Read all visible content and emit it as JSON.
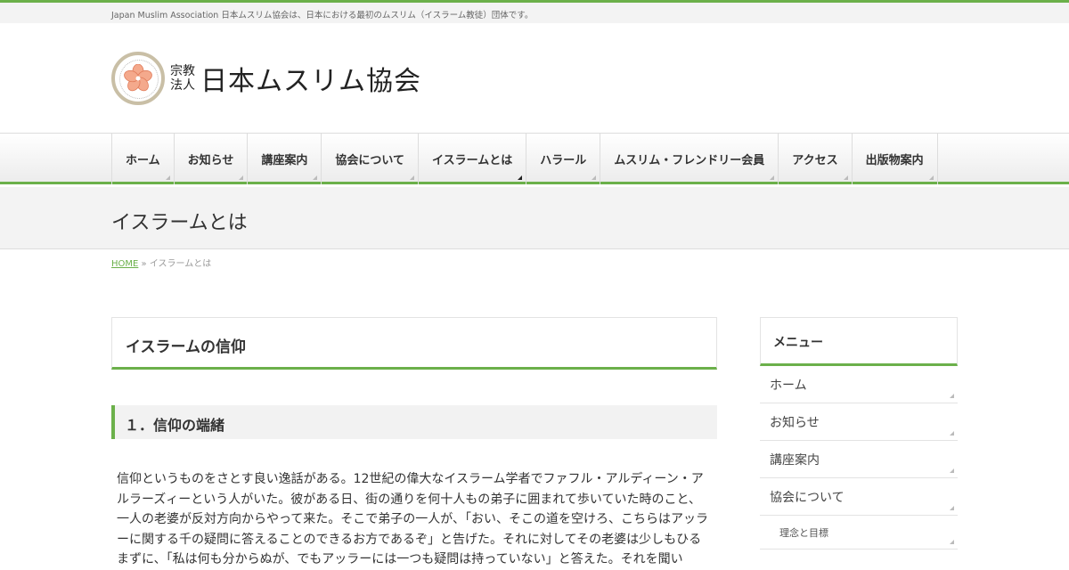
{
  "site": {
    "tagline": "Japan Muslim Association 日本ムスリム協会は、日本における最初のムスリム（イスラーム教徒）団体です。",
    "org_small_1": "宗教",
    "org_small_2": "法人",
    "org_name": "日本ムスリム協会"
  },
  "nav": {
    "items": [
      "ホーム",
      "お知らせ",
      "講座案内",
      "協会について",
      "イスラームとは",
      "ハラール",
      "ムスリム・フレンドリー会員",
      "アクセス",
      "出版物案内"
    ],
    "active_index": 4
  },
  "page": {
    "title": "イスラームとは",
    "breadcrumb_home": "HOME",
    "breadcrumb_sep": "»",
    "breadcrumb_current": "イスラームとは"
  },
  "article": {
    "heading": "イスラームの信仰",
    "section_heading": "１．信仰の端緒",
    "body": "信仰というものをさとす良い逸話がある。12世紀の偉大なイスラーム学者でファフル・アルディーン・アルラーズィーという人がいた。彼がある日、街の通りを何十人もの弟子に囲まれて歩いていた時のこと、一人の老婆が反対方向からやって来た。そこで弟子の一人が、「おい、そこの道を空けろ、こちらはアッラーに関する千の疑問に答えることのできるお方であるぞ」と告げた。それに対してその老婆は少しもひるまずに、「私は何も分からぬが、でもアッラーには一つも疑問は持っていない」と答えた。それを聞い"
  },
  "sidebar": {
    "title": "メニュー",
    "items": [
      "ホーム",
      "お知らせ",
      "講座案内",
      "協会について"
    ],
    "sub_items": [
      "理念と目標"
    ]
  },
  "colors": {
    "accent": "#6bb04a",
    "sakura": "#f4a98c"
  }
}
